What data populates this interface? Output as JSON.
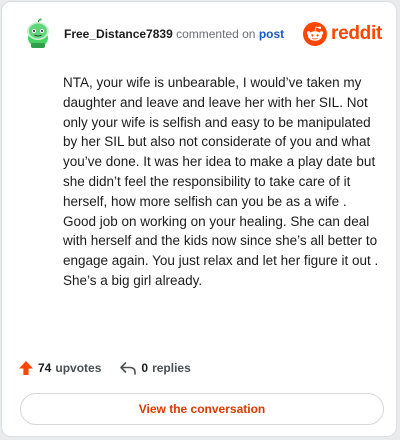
{
  "comment": {
    "username": "Free_Distance7839",
    "action_text": "commented on",
    "post_link_text": "post",
    "body": "NTA, your wife is unbearable, I would’ve taken my daughter and leave and leave her with her SIL. Not only your wife is selfish and easy to be manipulated by her SIL but also not considerate of you and what you’ve done. It was her idea to make a play date but she didn’t feel the responsibility to take care of it herself, how more selfish can you be as a wife . Good job on working on your healing. She can deal with herself and the kids now since she’s all better to engage again. You just relax and let her figure it out . She’s a big girl already."
  },
  "brand": {
    "name": "reddit",
    "icon": "reddit-logo-icon",
    "color": "#ff4500"
  },
  "stats": {
    "upvotes_count": "74",
    "upvotes_label": "upvotes",
    "upvote_icon": "upvote-arrow-icon",
    "upvote_color": "#ff4500",
    "replies_count": "0",
    "replies_label": "replies",
    "reply_icon": "reply-arrow-icon"
  },
  "cta": {
    "label": "View the conversation",
    "color": "#d93a00"
  },
  "colors": {
    "link": "#1a57c7",
    "avatar_green": "#46d160"
  }
}
